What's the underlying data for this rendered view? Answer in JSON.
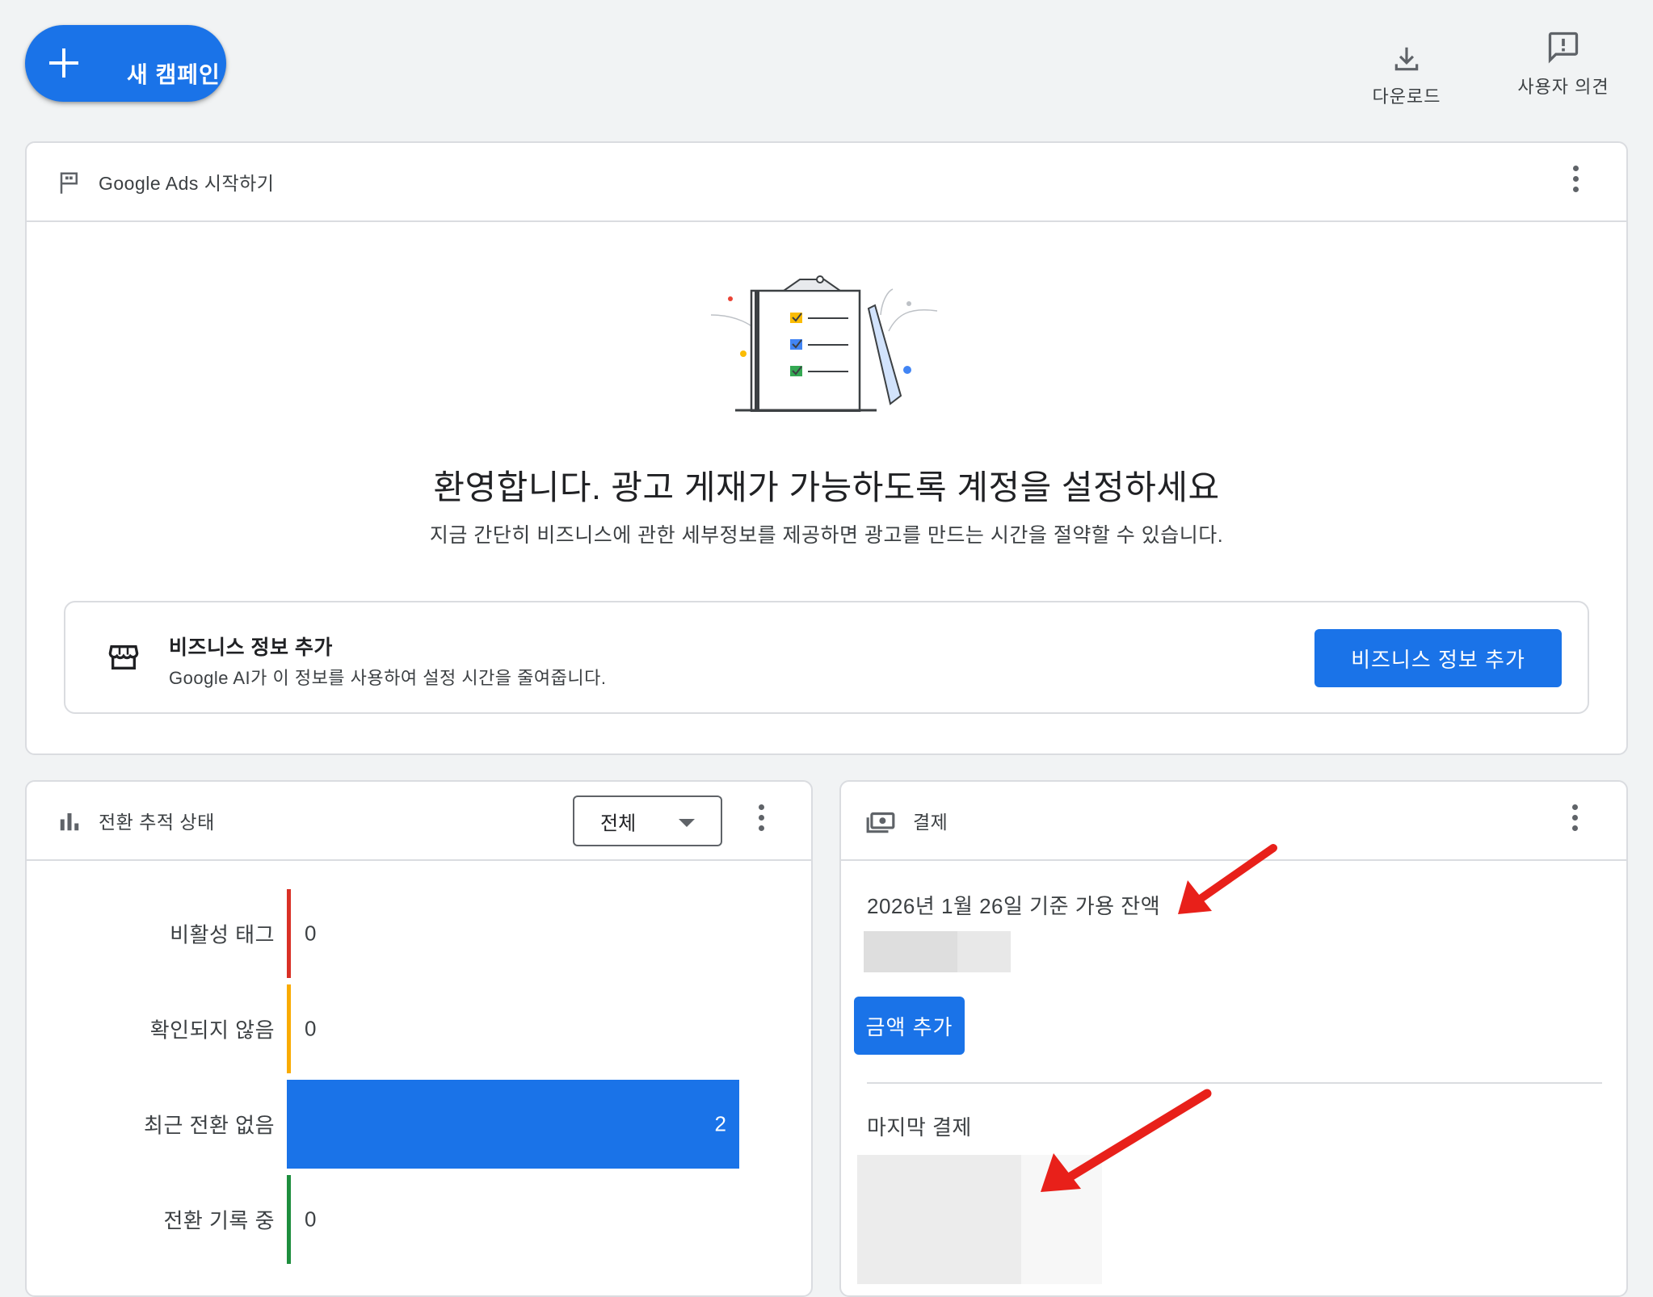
{
  "topbar": {
    "new_campaign_label": "새 캠페인",
    "download_label": "다운로드",
    "feedback_label": "사용자 의견"
  },
  "welcome": {
    "header_title": "Google Ads 시작하기",
    "title": "환영합니다. 광고 게재가 가능하도록 계정을 설정하세요",
    "subtitle": "지금 간단히 비즈니스에 관한 세부정보를 제공하면 광고를 만드는 시간을 절약할 수 있습니다.",
    "biz_title": "비즈니스 정보 추가",
    "biz_desc": "Google AI가 이 정보를 사용하여 설정 시간을 줄여줍니다.",
    "biz_button": "비즈니스 정보 추가"
  },
  "conversion": {
    "header_title": "전환 추적 상태",
    "filter_value": "전체",
    "rows": [
      {
        "label": "비활성 태그",
        "value": "0",
        "color": "#d93025"
      },
      {
        "label": "확인되지 않음",
        "value": "0",
        "color": "#f9ab00"
      },
      {
        "label": "최근 전환 없음",
        "value": "2",
        "color": "#1a73e8"
      },
      {
        "label": "전환 기록 중",
        "value": "0",
        "color": "#1e8e3e"
      }
    ]
  },
  "chart_data": {
    "type": "bar",
    "orientation": "horizontal",
    "categories": [
      "비활성 태그",
      "확인되지 않음",
      "최근 전환 없음",
      "전환 기록 중"
    ],
    "values": [
      0,
      0,
      2,
      0
    ],
    "colors": [
      "#d93025",
      "#f9ab00",
      "#1a73e8",
      "#1e8e3e"
    ]
  },
  "billing": {
    "header_title": "결제",
    "balance_label": "2026년 1월 26일 기준 가용 잔액",
    "add_funds_button": "금액 추가",
    "last_payment_label": "마지막 결제"
  },
  "colors": {
    "primary": "#1a73e8",
    "annotation_arrow": "#e8201a"
  }
}
